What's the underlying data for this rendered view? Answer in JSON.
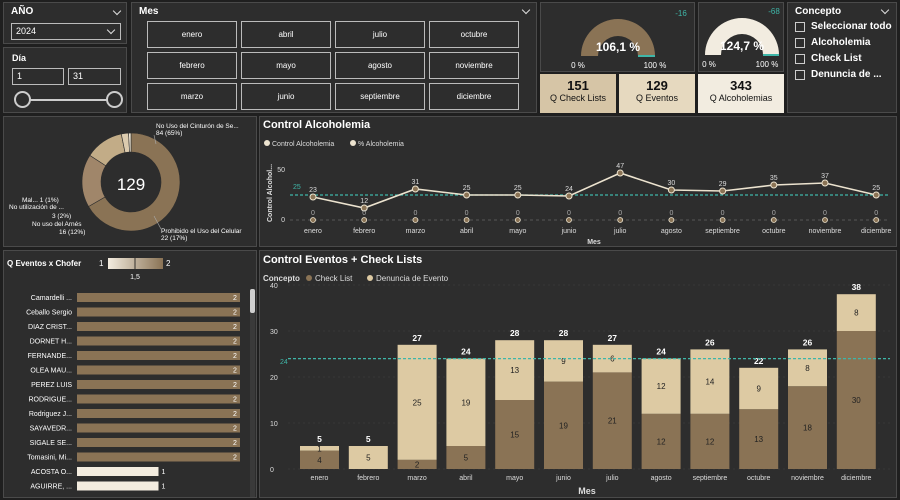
{
  "year_filter": {
    "title": "AÑO",
    "value": "2024"
  },
  "day_filter": {
    "title": "Día",
    "from": "1",
    "to": "31"
  },
  "month_filter": {
    "title": "Mes",
    "months": [
      "enero",
      "abril",
      "julio",
      "octubre",
      "febrero",
      "mayo",
      "agosto",
      "noviembre",
      "marzo",
      "junio",
      "septiembre",
      "diciembre"
    ]
  },
  "gauges": [
    {
      "value_label": "106,1 %",
      "min_label": "0 %",
      "max_label": "100 %",
      "delta": "-16",
      "fraction": 1.0
    },
    {
      "value_label": "124,7 %",
      "min_label": "0 %",
      "max_label": "100 %",
      "delta": "-68",
      "fraction": 1.0
    }
  ],
  "kpis": [
    {
      "value": "151",
      "label": "Q Check Lists",
      "color": "#d6c5a6"
    },
    {
      "value": "129",
      "label": "Q Eventos",
      "color": "#e6d9bf"
    },
    {
      "value": "343",
      "label": "Q Alcoholemias",
      "color": "#f2ece0"
    }
  ],
  "concepto_filter": {
    "title": "Concepto",
    "options": [
      "Seleccionar todo",
      "Alcoholemia",
      "Check List",
      "Denuncia de ..."
    ]
  },
  "donut": {
    "center_label": "129",
    "labels": {
      "top_name": "No Uso del Cinturón de Se...",
      "top_value": "84 (65%)",
      "bottom_name": "Prohibido el Uso del Celular",
      "bottom_value": "22 (17%)",
      "left1": "Mal... 1 (1%)",
      "left2": "No utilización de ...",
      "left3": "3 (2%)",
      "left4": "No uso del Arnés",
      "left5": "16 (12%)"
    },
    "chart_data": {
      "type": "pie",
      "segments": [
        {
          "name": "No Uso del Cinturón de Se...",
          "value": 84,
          "color": "#8a7355"
        },
        {
          "name": "Prohibido el Uso del Celular",
          "value": 22,
          "color": "#a0866a"
        },
        {
          "name": "No uso del Arnés",
          "value": 16,
          "color": "#c2ac87"
        },
        {
          "name": "No utilización de ...",
          "value": 3,
          "color": "#dccbae"
        },
        {
          "name": "Mal...",
          "value": 1,
          "color": "#efe5d3"
        }
      ]
    }
  },
  "alcoholemia": {
    "title": "Control Alcoholemia",
    "legend": [
      "Control Alcoholemia",
      "% Alcoholemia"
    ],
    "chart_data": {
      "type": "line",
      "categories": [
        "enero",
        "febrero",
        "marzo",
        "abril",
        "mayo",
        "junio",
        "julio",
        "agosto",
        "septiembre",
        "octubre",
        "noviembre",
        "diciembre"
      ],
      "series": [
        {
          "name": "Control Alcoholemia",
          "values": [
            23,
            12,
            31,
            25,
            25,
            24,
            47,
            30,
            29,
            35,
            37,
            25
          ]
        },
        {
          "name": "% Alcoholemia",
          "values": [
            0,
            0,
            0,
            0,
            0,
            0,
            0,
            0,
            0,
            0,
            0,
            0
          ]
        }
      ],
      "reference_line": 25,
      "reference_label": "25",
      "xlabel": "Mes",
      "ylabel": "Control Alcohol...",
      "yticks": [
        "0",
        "50"
      ],
      "ylim": [
        -10,
        60
      ]
    }
  },
  "chofer": {
    "title": "Q Eventos x Chofer",
    "legend_min": "1",
    "legend_max": "2",
    "legend_mid": "1,5",
    "chart_data": {
      "type": "bar",
      "categories": [
        "Camardelli ...",
        "Ceballo Sergio",
        "DIAZ CRIST...",
        "DORNET H...",
        "FERNANDE...",
        "OLEA MAU...",
        "PEREZ LUIS",
        "RODRIGUE...",
        "Rodriguez J...",
        "SAYAVEDR...",
        "SIGALE SE...",
        "Tomasini, Mi...",
        "ACOSTA O...",
        "AGUIRRE, ..."
      ],
      "values": [
        2,
        2,
        2,
        2,
        2,
        2,
        2,
        2,
        2,
        2,
        2,
        2,
        1,
        1
      ],
      "xlim": [
        0,
        2
      ]
    }
  },
  "eventos": {
    "title": "Control Eventos + Check Lists",
    "legend_title": "Concepto",
    "legend": [
      "Check List",
      "Denuncia de Evento"
    ],
    "colors": {
      "check_list": "#8a7355",
      "denuncia": "#ddcaa3"
    },
    "chart_data": {
      "type": "bar",
      "categories": [
        "enero",
        "febrero",
        "marzo",
        "abril",
        "mayo",
        "junio",
        "julio",
        "agosto",
        "septiembre",
        "octubre",
        "noviembre",
        "diciembre"
      ],
      "series": [
        {
          "name": "Check List",
          "values": [
            4,
            0,
            2,
            5,
            15,
            19,
            21,
            12,
            12,
            13,
            18,
            30
          ]
        },
        {
          "name": "Denuncia de Evento",
          "values": [
            1,
            5,
            25,
            19,
            13,
            9,
            6,
            12,
            14,
            9,
            8,
            8
          ]
        }
      ],
      "totals": [
        5,
        5,
        27,
        24,
        28,
        28,
        27,
        24,
        26,
        22,
        26,
        38
      ],
      "reference_line": 24,
      "reference_label": "24",
      "xlabel": "Mes",
      "yticks": [
        "0",
        "10",
        "20",
        "30",
        "40"
      ],
      "ylim": [
        0,
        40
      ]
    }
  }
}
